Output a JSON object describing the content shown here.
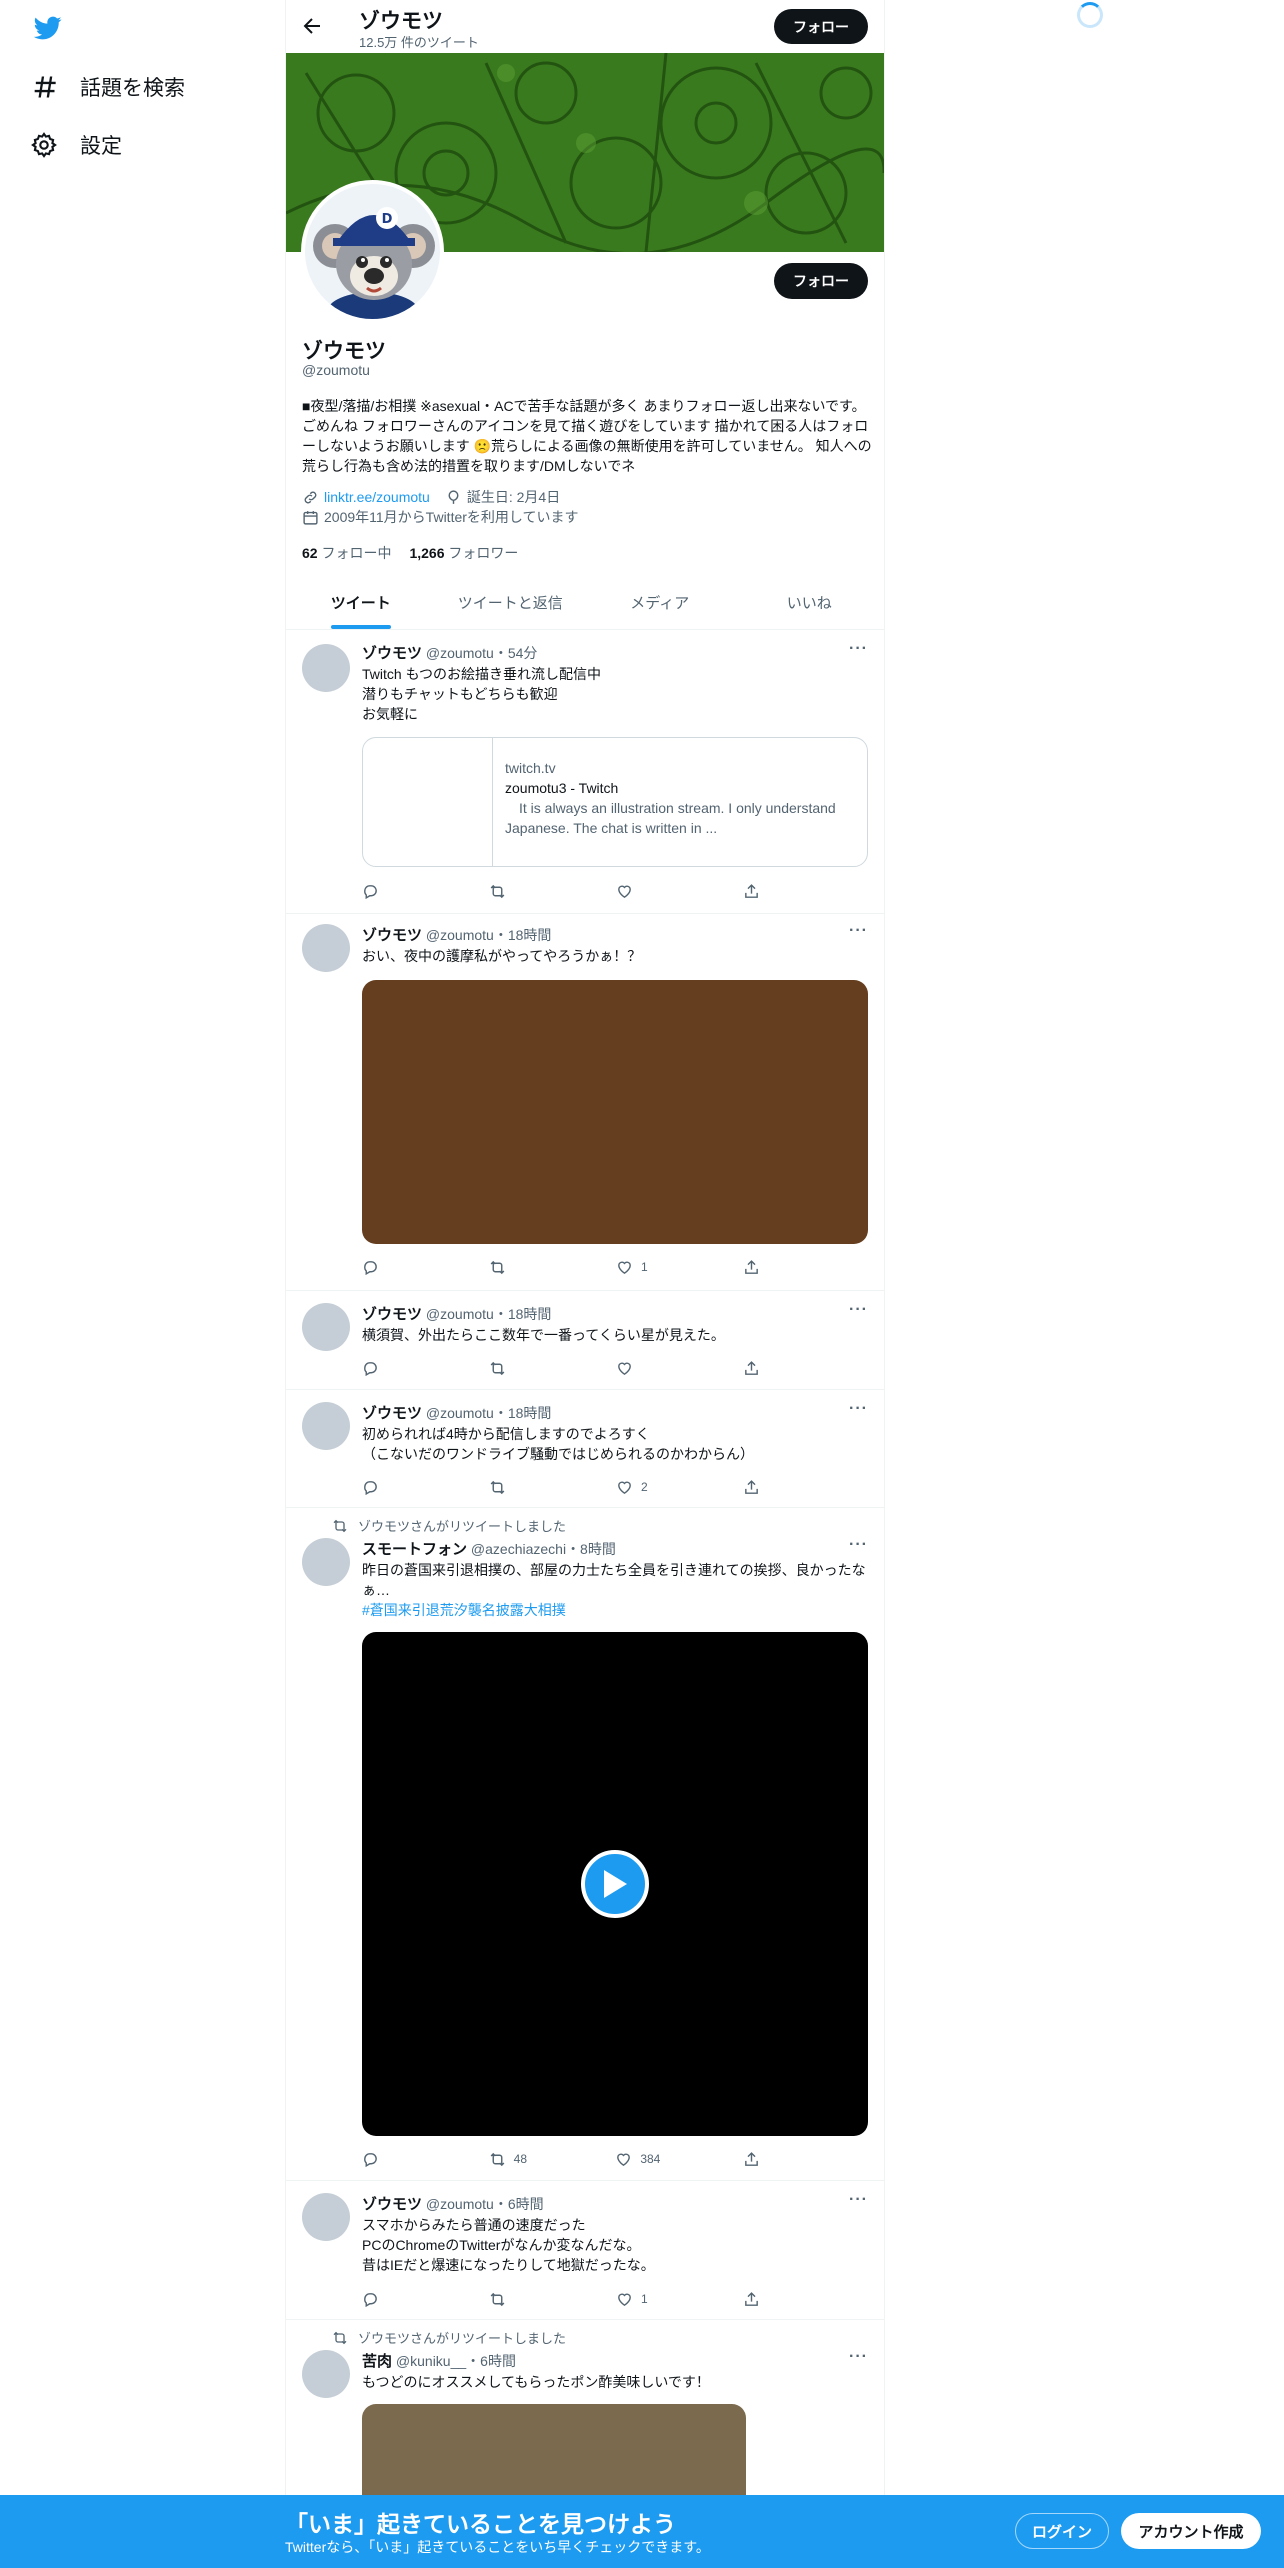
{
  "sidebar": {
    "explore_label": "話題を検索",
    "settings_label": "設定"
  },
  "header": {
    "title": "ゾウモツ",
    "tweet_count": "12.5万 件のツイート",
    "follow_label": "フォロー"
  },
  "profile": {
    "name": "ゾウモツ",
    "handle": "@zoumotu",
    "follow_label": "フォロー",
    "bio": "■夜型/落描/お相撲 ※asexual・ACで苦手な話題が多く あまりフォロー返し出来ないです。ごめんね フォロワーさんのアイコンを見て描く遊びをしています 描かれて困る人はフォローしないようお願いします 🙁荒らしによる画像の無断使用を許可していません。 知人への荒らし行為も含め法的措置を取ります/DMしないでネ",
    "link": "linktr.ee/zoumotu",
    "birthday": "誕生日: 2月4日",
    "joined": "2009年11月からTwitterを利用しています",
    "following_count": "62",
    "following_label": "フォロー中",
    "followers_count": "1,266",
    "followers_label": "フォロワー"
  },
  "tabs": [
    "ツイート",
    "ツイートと返信",
    "メディア",
    "いいね"
  ],
  "tweets": [
    {
      "name": "ゾウモツ",
      "handle": "@zoumotu",
      "time": "・54分",
      "text": "Twitch もつのお絵描き垂れ流し配信中\n潜りもチャットもどちらも歓迎\nお気軽に",
      "card": {
        "domain": "twitch.tv",
        "title": "zoumotu3 - Twitch",
        "desc": "　It is always an illustration stream. I only understand Japanese. The chat is written in ..."
      },
      "likes": ""
    },
    {
      "name": "ゾウモツ",
      "handle": "@zoumotu",
      "time": "・18時間",
      "text": "おい、夜中の護摩私がやってやろうかぁ！？",
      "media_color": "#653e1f",
      "likes": "1"
    },
    {
      "name": "ゾウモツ",
      "handle": "@zoumotu",
      "time": "・18時間",
      "text": "横須賀、外出たらここ数年で一番ってくらい星が見えた。",
      "likes": ""
    },
    {
      "name": "ゾウモツ",
      "handle": "@zoumotu",
      "time": "・18時間",
      "text": "初められれば4時から配信しますのでよろすく\n（こないだのワンドライブ騒動ではじめられるのかわからん）",
      "likes": "2"
    },
    {
      "retweet_note": "ゾウモツさんがリツイートしました",
      "name": "スモートフォン",
      "handle": "@azechiazechi",
      "time": "・8時間",
      "text": "昨日の蒼国来引退相撲の、部屋の力士たち全員を引き連れての挨拶、良かったなぁ…",
      "hashtag": "#蒼国来引退荒汐襲名披露大相撲",
      "retweets": "48",
      "likes": "384"
    },
    {
      "name": "ゾウモツ",
      "handle": "@zoumotu",
      "time": "・6時間",
      "text": "スマホからみたら普通の速度だった\nPCのChromeのTwitterがなんか変なんだな。\n昔はIEだと爆速になったりして地獄だったな。",
      "likes": "1"
    },
    {
      "retweet_note": "ゾウモツさんがリツイートしました",
      "name": "苦肉",
      "handle": "@kuniku__",
      "time": "・6時間",
      "text": "もつどのにオススメしてもらったポン酢美味しいです！",
      "media_color": "#7b6a4e"
    }
  ],
  "bottom_bar": {
    "title": "「いま」起きていることを見つけよう",
    "subtitle": "Twitterなら、「いま」起きていることをいち早くチェックできます。",
    "login_label": "ログイン",
    "signup_label": "アカウント作成"
  },
  "colors": {
    "accent": "#1d9bf0",
    "banner_green": "#3a7a1e"
  }
}
